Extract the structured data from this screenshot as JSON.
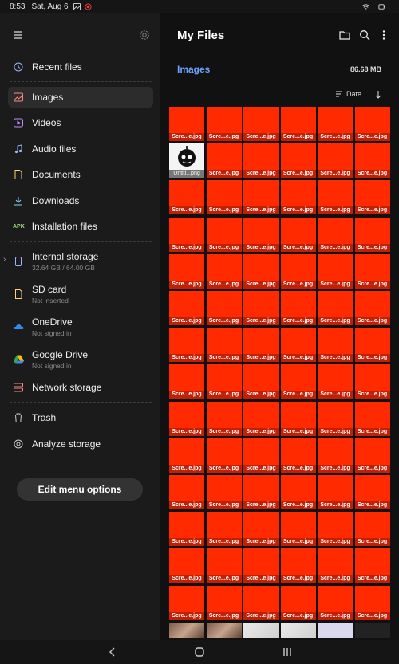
{
  "status": {
    "time": "8:53",
    "date": "Sat, Aug 6"
  },
  "drawer": {
    "items": [
      {
        "label": "Recent files",
        "icon": "clock-icon"
      },
      {
        "label": "Images",
        "icon": "image-icon",
        "active": true
      },
      {
        "label": "Videos",
        "icon": "video-icon"
      },
      {
        "label": "Audio files",
        "icon": "music-icon"
      },
      {
        "label": "Documents",
        "icon": "document-icon"
      },
      {
        "label": "Downloads",
        "icon": "download-icon"
      },
      {
        "label": "Installation files",
        "icon": "apk-icon",
        "icon_text": "APK"
      }
    ],
    "storage": [
      {
        "label": "Internal storage",
        "sub": "32.64 GB / 64.00 GB",
        "icon": "phone-icon"
      },
      {
        "label": "SD card",
        "sub": "Not inserted",
        "icon": "sdcard-icon"
      },
      {
        "label": "OneDrive",
        "sub": "Not signed in",
        "icon": "onedrive-icon"
      },
      {
        "label": "Google Drive",
        "sub": "Not signed in",
        "icon": "google-drive-icon"
      },
      {
        "label": "Network storage",
        "icon": "network-storage-icon"
      }
    ],
    "extra": [
      {
        "label": "Trash",
        "icon": "trash-icon"
      },
      {
        "label": "Analyze storage",
        "icon": "analyze-icon"
      }
    ],
    "edit_button": "Edit menu options"
  },
  "main": {
    "title": "My Files",
    "breadcrumb": "Images",
    "total_size": "86.68 MB",
    "sort_label": "Date",
    "thumb_caption": "Scre...e.jpg",
    "png_caption": "Untitl...png",
    "rows": 15,
    "cols": 6
  },
  "colors": {
    "accent": "#6fa1ff",
    "thumb": "#ff2a00",
    "thumb_caption_bg": "#c21f05"
  }
}
